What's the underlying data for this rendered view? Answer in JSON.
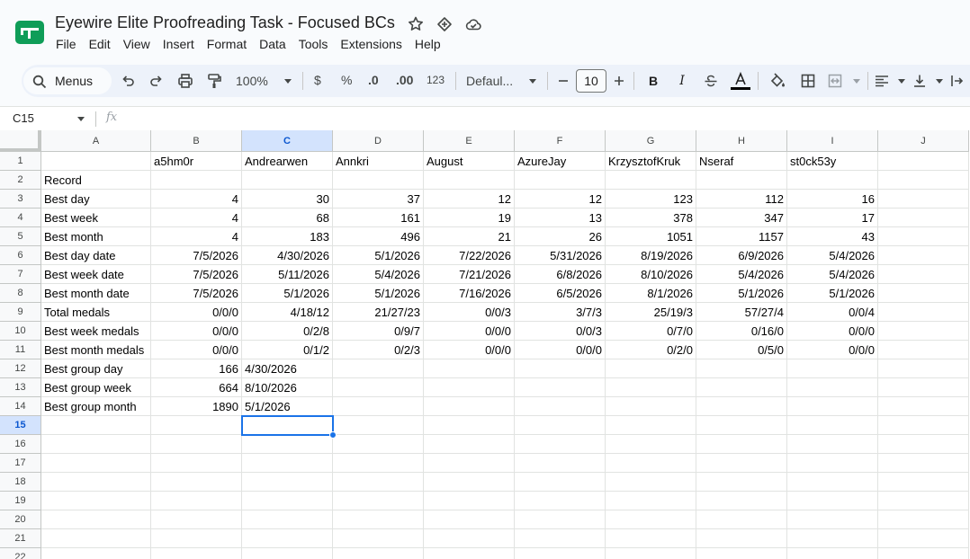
{
  "doc": {
    "title": "Eyewire Elite Proofreading Task - Focused BCs"
  },
  "menu": [
    "File",
    "Edit",
    "View",
    "Insert",
    "Format",
    "Data",
    "Tools",
    "Extensions",
    "Help"
  ],
  "toolbar": {
    "search_label": "Menus",
    "zoom": "100%",
    "currency": "$",
    "percent": "%",
    "dec_decrease": ".0",
    "dec_increase": ".00",
    "number_format": "123",
    "font": "Defaul...",
    "font_size": "10",
    "icons": [
      "search-icon",
      "undo-icon",
      "redo-icon",
      "print-icon",
      "paint-format-icon",
      "bold-icon",
      "italic-icon",
      "strikethrough-icon",
      "text-color-icon",
      "fill-color-icon",
      "borders-icon",
      "merge-cells-icon",
      "align-left-icon",
      "valign-bottom-icon",
      "text-wrap-icon"
    ]
  },
  "formula_bar": {
    "cell_ref": "C15",
    "fx": "fx",
    "value": ""
  },
  "colors": {
    "accent": "#1a73e8",
    "selected_header": "#d3e3fd",
    "logo_green": "#0f9d58"
  },
  "sheet": {
    "columns": [
      "A",
      "B",
      "C",
      "D",
      "E",
      "F",
      "G",
      "H",
      "I",
      "J"
    ],
    "row_numbers": [
      "1",
      "2",
      "3",
      "4",
      "5",
      "6",
      "7",
      "8",
      "9",
      "10",
      "11",
      "12",
      "13",
      "14",
      "15",
      "16",
      "17",
      "18",
      "19",
      "20",
      "21",
      "22"
    ],
    "selected_cell": "C15",
    "rows": [
      [
        "",
        "a5hm0r",
        "Andrearwen",
        "Annkri",
        "August",
        "AzureJay",
        "KrzysztofKruk",
        "Nseraf",
        "st0ck53y",
        ""
      ],
      [
        "Record",
        "",
        "",
        "",
        "",
        "",
        "",
        "",
        "",
        ""
      ],
      [
        "Best day",
        "4",
        "30",
        "37",
        "12",
        "12",
        "123",
        "112",
        "16",
        ""
      ],
      [
        "Best week",
        "4",
        "68",
        "161",
        "19",
        "13",
        "378",
        "347",
        "17",
        ""
      ],
      [
        "Best month",
        "4",
        "183",
        "496",
        "21",
        "26",
        "1051",
        "1157",
        "43",
        ""
      ],
      [
        "Best day date",
        "7/5/2026",
        "4/30/2026",
        "5/1/2026",
        "7/22/2026",
        "5/31/2026",
        "8/19/2026",
        "6/9/2026",
        "5/4/2026",
        ""
      ],
      [
        "Best week date",
        "7/5/2026",
        "5/11/2026",
        "5/4/2026",
        "7/21/2026",
        "6/8/2026",
        "8/10/2026",
        "5/4/2026",
        "5/4/2026",
        ""
      ],
      [
        "Best month date",
        "7/5/2026",
        "5/1/2026",
        "5/1/2026",
        "7/16/2026",
        "6/5/2026",
        "8/1/2026",
        "5/1/2026",
        "5/1/2026",
        ""
      ],
      [
        "Total medals",
        "0/0/0",
        "4/18/12",
        "21/27/23",
        "0/0/3",
        "3/7/3",
        "25/19/3",
        "57/27/4",
        "0/0/4",
        ""
      ],
      [
        "Best week medals",
        "0/0/0",
        "0/2/8",
        "0/9/7",
        "0/0/0",
        "0/0/3",
        "0/7/0",
        "0/16/0",
        "0/0/0",
        ""
      ],
      [
        "Best month medals",
        "0/0/0",
        "0/1/2",
        "0/2/3",
        "0/0/0",
        "0/0/0",
        "0/2/0",
        "0/5/0",
        "0/0/0",
        ""
      ],
      [
        "Best group day",
        "166",
        "4/30/2026",
        "",
        "",
        "",
        "",
        "",
        "",
        ""
      ],
      [
        "Best group week",
        "664",
        "8/10/2026",
        "",
        "",
        "",
        "",
        "",
        "",
        ""
      ],
      [
        "Best group month",
        "1890",
        "5/1/2026",
        "",
        "",
        "",
        "",
        "",
        "",
        ""
      ],
      [
        "",
        "",
        "",
        "",
        "",
        "",
        "",
        "",
        "",
        ""
      ],
      [
        "",
        "",
        "",
        "",
        "",
        "",
        "",
        "",
        "",
        ""
      ],
      [
        "",
        "",
        "",
        "",
        "",
        "",
        "",
        "",
        "",
        ""
      ],
      [
        "",
        "",
        "",
        "",
        "",
        "",
        "",
        "",
        "",
        ""
      ],
      [
        "",
        "",
        "",
        "",
        "",
        "",
        "",
        "",
        "",
        ""
      ],
      [
        "",
        "",
        "",
        "",
        "",
        "",
        "",
        "",
        "",
        ""
      ],
      [
        "",
        "",
        "",
        "",
        "",
        "",
        "",
        "",
        "",
        ""
      ],
      [
        "",
        "",
        "",
        "",
        "",
        "",
        "",
        "",
        "",
        ""
      ]
    ]
  }
}
